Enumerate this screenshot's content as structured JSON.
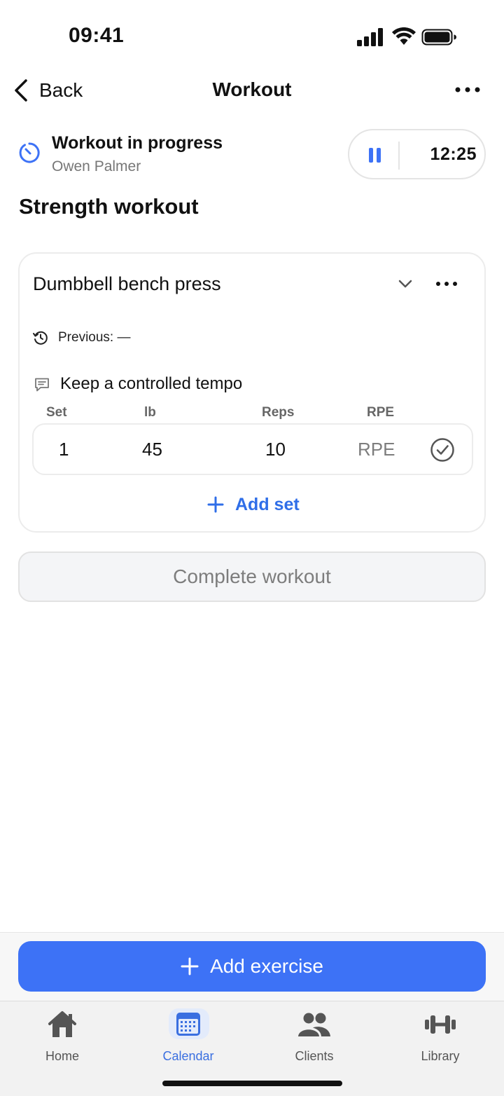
{
  "status_bar": {
    "time": "09:41",
    "icons": [
      "signal-icon",
      "wifi-icon",
      "battery-icon"
    ]
  },
  "nav": {
    "back_label": "Back",
    "title": "Workout",
    "more_icon": "more-horizontal-icon"
  },
  "progress": {
    "title": "Workout in progress",
    "client_name": "Owen Palmer",
    "timer": "12:25",
    "icon": "timer-icon",
    "pause_icon": "pause-icon"
  },
  "workout_title": "Strength workout",
  "exercise": {
    "name": "Dumbbell bench press",
    "previous": "Previous: —",
    "note": "Keep a controlled tempo",
    "columns": [
      "Set",
      "lb",
      "Reps",
      "RPE"
    ],
    "sets": [
      {
        "set": "1",
        "lb": "45",
        "reps": "10",
        "rpe_placeholder": "RPE",
        "completed": false
      }
    ],
    "add_set_label": "Add set"
  },
  "complete_label": "Complete workout",
  "add_exercise_label": "Add exercise",
  "tabs": [
    {
      "label": "Home",
      "icon": "home-icon",
      "active": false
    },
    {
      "label": "Calendar",
      "icon": "calendar-icon",
      "active": true
    },
    {
      "label": "Clients",
      "icon": "clients-icon",
      "active": false
    },
    {
      "label": "Library",
      "icon": "dumbbell-icon",
      "active": false
    }
  ],
  "colors": {
    "accent": "#3d72f6",
    "link": "#2f6ee8",
    "muted_text": "#777777",
    "card_border": "#ececec"
  }
}
